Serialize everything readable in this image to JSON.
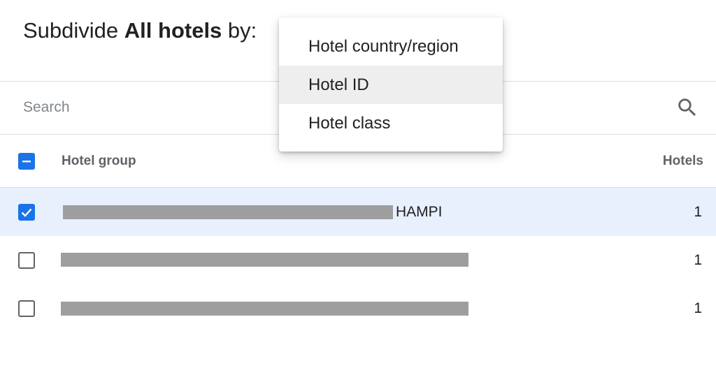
{
  "heading": {
    "prefix": "Subdivide ",
    "bold": "All hotels",
    "suffix": " by:"
  },
  "search": {
    "placeholder": "Search",
    "icon": "search-icon"
  },
  "table": {
    "select_all_state": "indeterminate",
    "columns": {
      "group": "Hotel group",
      "hotels": "Hotels"
    },
    "rows": [
      {
        "checked": true,
        "group_visible_suffix": "HAMPI",
        "hotels": "1"
      },
      {
        "checked": false,
        "group_visible_suffix": "",
        "hotels": "1"
      },
      {
        "checked": false,
        "group_visible_suffix": "",
        "hotels": "1"
      }
    ]
  },
  "dropdown_menu": {
    "items": [
      {
        "label": "Hotel country/region"
      },
      {
        "label": "Hotel ID",
        "highlighted": true
      },
      {
        "label": "Hotel class"
      }
    ]
  },
  "colors": {
    "accent": "#1a73e8",
    "selected_row_bg": "#e8f0fe",
    "highlighted_menu_bg": "#eeeeee",
    "redaction": "#9e9e9e"
  }
}
